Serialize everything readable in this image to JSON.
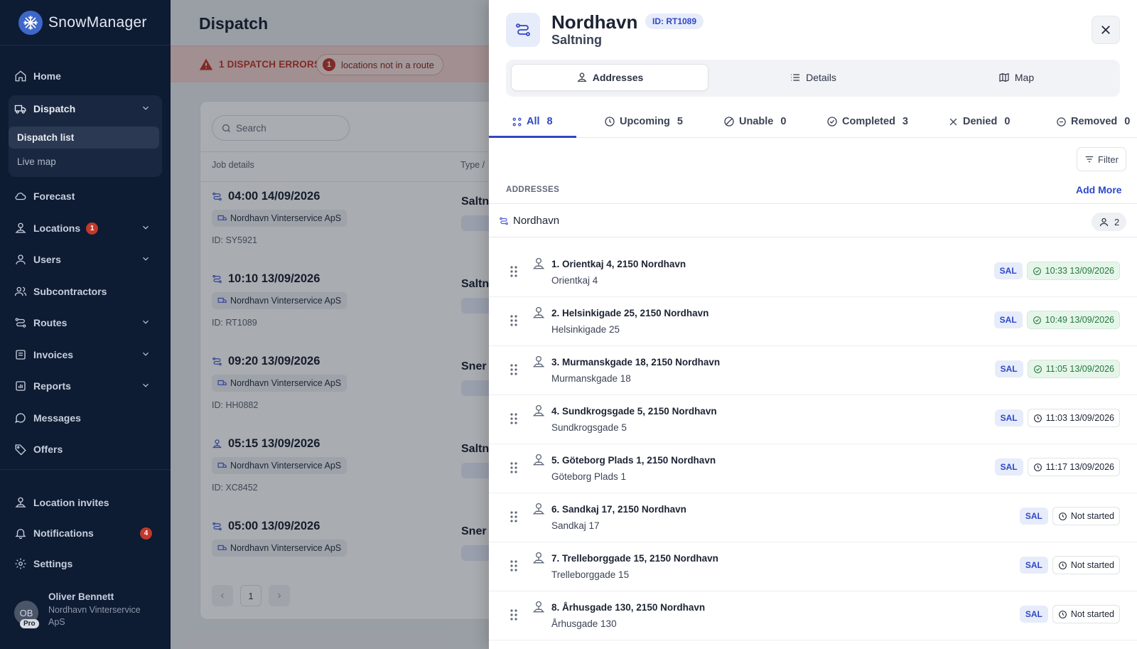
{
  "app": {
    "name": "SnowManager"
  },
  "sidebar": {
    "items": [
      {
        "label": "Home",
        "icon": "home-icon"
      },
      {
        "label": "Dispatch",
        "icon": "truck-icon",
        "expanded": true,
        "children": [
          "Dispatch list",
          "Live map"
        ]
      },
      {
        "label": "Forecast",
        "icon": "cloud-icon"
      },
      {
        "label": "Locations",
        "icon": "location-icon",
        "badge": "1"
      },
      {
        "label": "Users",
        "icon": "user-icon"
      },
      {
        "label": "Subcontractors",
        "icon": "users-icon"
      },
      {
        "label": "Routes",
        "icon": "route-icon"
      },
      {
        "label": "Invoices",
        "icon": "invoice-icon"
      },
      {
        "label": "Reports",
        "icon": "chart-icon"
      },
      {
        "label": "Messages",
        "icon": "message-icon"
      },
      {
        "label": "Offers",
        "icon": "tag-icon"
      }
    ],
    "bottom": [
      {
        "label": "Location invites",
        "icon": "location-icon"
      },
      {
        "label": "Notifications",
        "icon": "bell-icon",
        "badge": "4"
      },
      {
        "label": "Settings",
        "icon": "gear-icon"
      }
    ],
    "user": {
      "initials": "OB",
      "plan": "Pro",
      "name": "Oliver Bennett",
      "org": "Nordhavn Vinterservice ApS"
    }
  },
  "main": {
    "title": "Dispatch",
    "error": {
      "text": "1 DISPATCH ERRORS",
      "count": "1",
      "pill": "locations not in a route"
    },
    "search_placeholder": "Search",
    "columns": [
      "Job details",
      "Type /"
    ],
    "jobs": [
      {
        "time": "04:00 14/09/2026",
        "org": "Nordhavn Vinterservice ApS",
        "id": "ID: SY5921",
        "type": "Saltn",
        "icon": "route-icon"
      },
      {
        "time": "10:10 13/09/2026",
        "org": "Nordhavn Vinterservice ApS",
        "id": "ID: RT1089",
        "type": "Saltn",
        "icon": "route-icon"
      },
      {
        "time": "09:20 13/09/2026",
        "org": "Nordhavn Vinterservice ApS",
        "id": "ID: HH0882",
        "type": "Sner",
        "icon": "route-icon"
      },
      {
        "time": "05:15 13/09/2026",
        "org": "Nordhavn Vinterservice ApS",
        "id": "ID: XC8452",
        "type": "Saltn",
        "icon": "location-icon"
      },
      {
        "time": "05:00 13/09/2026",
        "org": "Nordhavn Vinterservice ApS",
        "id": "",
        "type": "Sner",
        "icon": "route-icon"
      }
    ],
    "page": "1"
  },
  "drawer": {
    "title": "Nordhavn",
    "id_badge": "ID: RT1089",
    "subtitle": "Saltning",
    "segments": [
      "Addresses",
      "Details",
      "Map"
    ],
    "tabs": [
      {
        "label": "All",
        "count": "8"
      },
      {
        "label": "Upcoming",
        "count": "5"
      },
      {
        "label": "Unable",
        "count": "0"
      },
      {
        "label": "Completed",
        "count": "3"
      },
      {
        "label": "Denied",
        "count": "0"
      },
      {
        "label": "Removed",
        "count": "0"
      }
    ],
    "filter_label": "Filter",
    "addresses_label": "ADDRESSES",
    "add_more_label": "Add More",
    "group": {
      "name": "Nordhavn",
      "count": "2"
    },
    "addresses": [
      {
        "title": "1. Orientkaj 4, 2150 Nordhavn",
        "sub": "Orientkaj 4",
        "tag": "SAL",
        "status": "10:33 13/09/2026",
        "state": "done"
      },
      {
        "title": "2. Helsinkigade 25, 2150 Nordhavn",
        "sub": "Helsinkigade 25",
        "tag": "SAL",
        "status": "10:49 13/09/2026",
        "state": "done"
      },
      {
        "title": "3. Murmanskgade 18, 2150 Nordhavn",
        "sub": "Murmanskgade 18",
        "tag": "SAL",
        "status": "11:05 13/09/2026",
        "state": "done"
      },
      {
        "title": "4. Sundkrogsgade 5, 2150 Nordhavn",
        "sub": "Sundkrogsgade 5",
        "tag": "SAL",
        "status": "11:03 13/09/2026",
        "state": "scheduled"
      },
      {
        "title": "5. Göteborg Plads 1, 2150 Nordhavn",
        "sub": "Göteborg Plads 1",
        "tag": "SAL",
        "status": "11:17 13/09/2026",
        "state": "scheduled"
      },
      {
        "title": "6. Sandkaj 17, 2150 Nordhavn",
        "sub": "Sandkaj 17",
        "tag": "SAL",
        "status": "Not started",
        "state": "scheduled"
      },
      {
        "title": "7. Trelleborggade 15, 2150 Nordhavn",
        "sub": "Trelleborggade 15",
        "tag": "SAL",
        "status": "Not started",
        "state": "scheduled"
      },
      {
        "title": "8. Århusgade 130, 2150 Nordhavn",
        "sub": "Århusgade 130",
        "tag": "SAL",
        "status": "Not started",
        "state": "scheduled"
      }
    ]
  }
}
